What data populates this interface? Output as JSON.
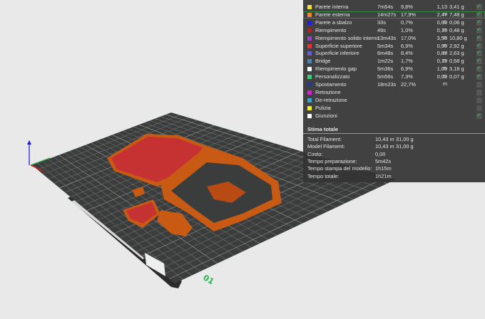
{
  "legend": {
    "rows": [
      {
        "label": "Parete interna",
        "time": "7m54s",
        "pct": "9,8%",
        "length": "1,13 m",
        "weight": "3,41 g",
        "color": "#f2e23a",
        "checked": true
      },
      {
        "label": "Parete esterna",
        "time": "14m27s",
        "pct": "17,9%",
        "length": "2,47 m",
        "weight": "7,48 g",
        "color": "#f4842c",
        "checked": true,
        "selected": true
      },
      {
        "label": "Parete a sbalzo",
        "time": "33s",
        "pct": "0,7%",
        "length": "0,02 m",
        "weight": "0,06 g",
        "color": "#1f1fe8",
        "checked": true
      },
      {
        "label": "Riempimento",
        "time": "49s",
        "pct": "1,0%",
        "length": "0,16 m",
        "weight": "0,48 g",
        "color": "#b32222",
        "checked": true
      },
      {
        "label": "Riempimento solido interno",
        "time": "13m43s",
        "pct": "17,0%",
        "length": "3,56 m",
        "weight": "10,80 g",
        "color": "#9a3fc8",
        "checked": true
      },
      {
        "label": "Superficie superiore",
        "time": "5m34s",
        "pct": "6,9%",
        "length": "0,96 m",
        "weight": "2,92 g",
        "color": "#e8303a",
        "checked": true
      },
      {
        "label": "Superficie inferiore",
        "time": "6m48s",
        "pct": "8,4%",
        "length": "0,87 m",
        "weight": "2,63 g",
        "color": "#6a5ad0",
        "checked": true
      },
      {
        "label": "Bridge",
        "time": "1m22s",
        "pct": "1,7%",
        "length": "0,19 m",
        "weight": "0,58 g",
        "color": "#4a7fb8",
        "checked": true
      },
      {
        "label": "Riempimento gap",
        "time": "5m36s",
        "pct": "6,9%",
        "length": "1,05 m",
        "weight": "3,18 g",
        "color": "#ffffff",
        "checked": true
      },
      {
        "label": "Personalizzato",
        "time": "5m56s",
        "pct": "7,3%",
        "length": "0,02 m",
        "weight": "0,07 g",
        "color": "#3ccf7a",
        "checked": true
      },
      {
        "label": "Spostamento",
        "time": "18m23s",
        "pct": "22,7%",
        "length": "",
        "weight": "",
        "color": "#2a3a8a",
        "checked": false
      },
      {
        "label": "Retrazione",
        "time": "",
        "pct": "",
        "length": "",
        "weight": "",
        "color": "#d81fd8",
        "checked": false
      },
      {
        "label": "De-retrazione",
        "time": "",
        "pct": "",
        "length": "",
        "weight": "",
        "color": "#2fa8d8",
        "checked": false
      },
      {
        "label": "Pulizia",
        "time": "",
        "pct": "",
        "length": "",
        "weight": "",
        "color": "#f2f21a",
        "checked": false
      },
      {
        "label": "Giunzioni",
        "time": "",
        "pct": "",
        "length": "",
        "weight": "",
        "color": "#ffffff",
        "checked": true
      }
    ]
  },
  "summary": {
    "title": "Stima totale",
    "rows": [
      {
        "key": "Total Filament:",
        "v1": "10,43 m",
        "v2": "31,00 g"
      },
      {
        "key": "Model Filament:",
        "v1": "10,43 m",
        "v2": "31,00 g"
      },
      {
        "key": "Costo:",
        "v1": "0,00",
        "v2": ""
      },
      {
        "key": "Tempo preparazione:",
        "v1": "5m42s",
        "v2": ""
      },
      {
        "key": "Tempo stampa del modello:",
        "v1": "1h15m",
        "v2": ""
      },
      {
        "key": "Tempo totale:",
        "v1": "1h21m",
        "v2": ""
      }
    ]
  },
  "plate": {
    "label": "01",
    "label_color": "#1fb84a"
  }
}
